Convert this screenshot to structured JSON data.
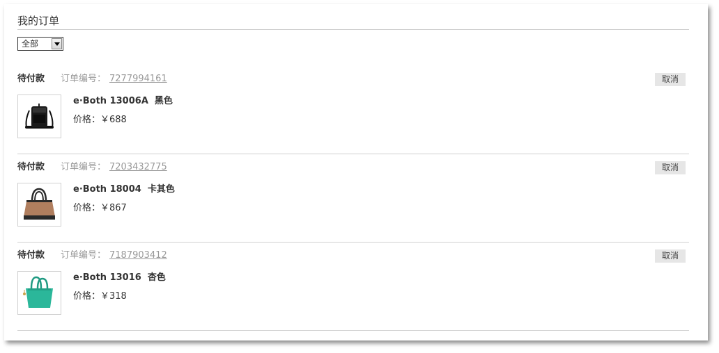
{
  "page": {
    "title": "我的订单"
  },
  "filter": {
    "selected": "全部"
  },
  "orders": [
    {
      "status": "待付款",
      "order_no_label": "订单编号：",
      "order_no": "7277994161",
      "cancel_label": "取消",
      "product_name": "e·Both 13006A  黑色",
      "price_label": "价格：",
      "price": "￥688",
      "image_icon": "black-crossbody-bag-icon",
      "bag_color": "#1a1a1a"
    },
    {
      "status": "待付款",
      "order_no_label": "订单编号：",
      "order_no": "7203432775",
      "cancel_label": "取消",
      "product_name": "e·Both 18004  卡其色",
      "price_label": "价格：",
      "price": "￥867",
      "image_icon": "khaki-handbag-icon",
      "bag_color": "#b07e5e"
    },
    {
      "status": "待付款",
      "order_no_label": "订单编号：",
      "order_no": "7187903412",
      "cancel_label": "取消",
      "product_name": "e·Both 13016  杏色",
      "price_label": "价格：",
      "price": "￥318",
      "image_icon": "teal-tote-bag-icon",
      "bag_color": "#2bb79a"
    }
  ]
}
